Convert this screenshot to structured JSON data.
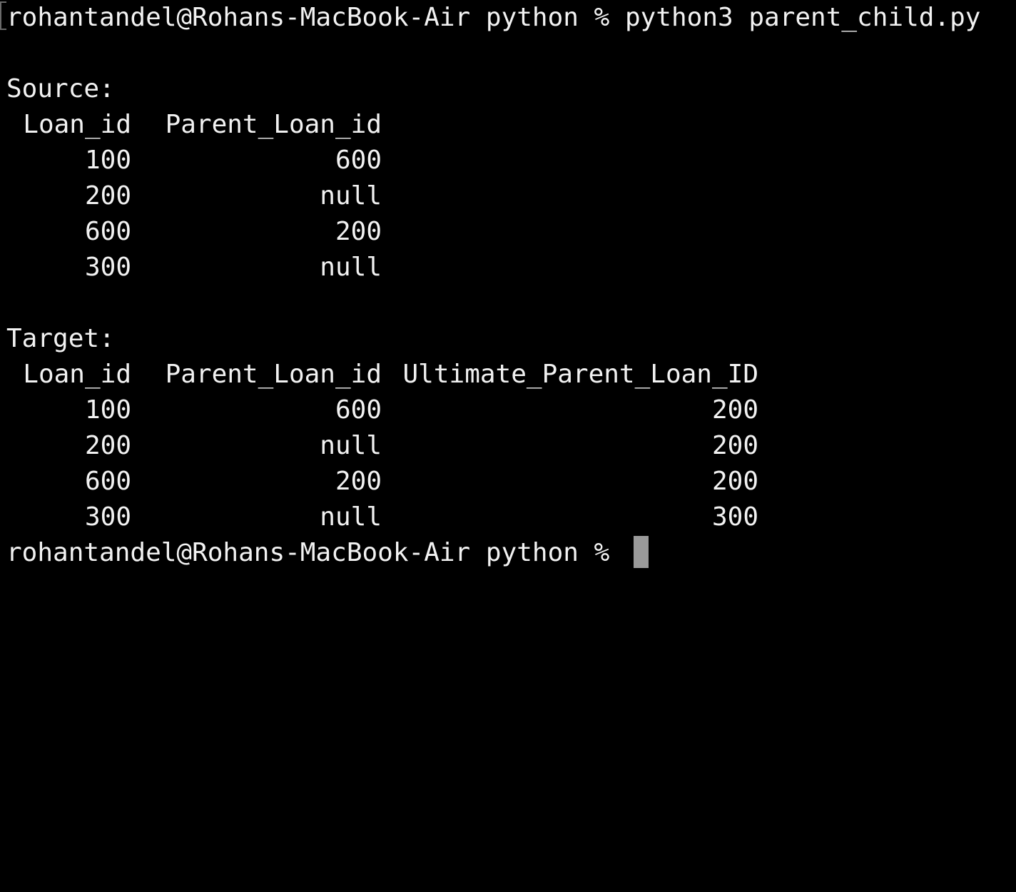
{
  "terminal": {
    "command_line": "rohantandel@Rohans-MacBook-Air python % python3 parent_child.py",
    "final_prompt": "rohantandel@Rohans-MacBook-Air python %",
    "colors": {
      "background": "#000000",
      "foreground": "#f2f2f2",
      "cursor": "#9a9a9a"
    }
  },
  "source": {
    "label": "Source:",
    "headers": [
      "Loan_id",
      "Parent_Loan_id"
    ],
    "rows": [
      [
        "100",
        "600"
      ],
      [
        "200",
        "null"
      ],
      [
        "600",
        "200"
      ],
      [
        "300",
        "null"
      ]
    ]
  },
  "target": {
    "label": "Target:",
    "headers": [
      "Loan_id",
      "Parent_Loan_id",
      "Ultimate_Parent_Loan_ID"
    ],
    "rows": [
      [
        "100",
        "600",
        "200"
      ],
      [
        "200",
        "null",
        "200"
      ],
      [
        "600",
        "200",
        "200"
      ],
      [
        "300",
        "null",
        "300"
      ]
    ]
  }
}
